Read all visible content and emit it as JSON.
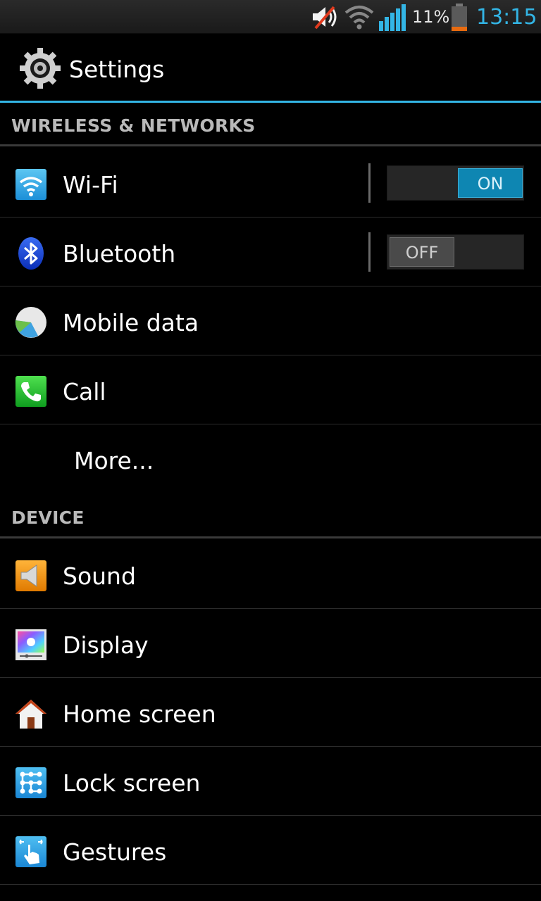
{
  "status_bar": {
    "battery_percent": "11%",
    "time": "13:15",
    "icons": [
      "mute-icon",
      "wifi-signal-icon",
      "cell-signal-icon",
      "battery-low-icon"
    ]
  },
  "action_bar": {
    "title": "Settings",
    "icon": "settings-gear-icon",
    "accent_color": "#33b5e5"
  },
  "sections": {
    "wireless": {
      "header": "WIRELESS & NETWORKS",
      "items": [
        {
          "label": "Wi-Fi",
          "icon": "wifi-icon",
          "toggle": "ON"
        },
        {
          "label": "Bluetooth",
          "icon": "bluetooth-icon",
          "toggle": "OFF"
        },
        {
          "label": "Mobile data",
          "icon": "mobile-data-icon"
        },
        {
          "label": "Call",
          "icon": "phone-icon"
        },
        {
          "label": "More..."
        }
      ]
    },
    "device": {
      "header": "DEVICE",
      "items": [
        {
          "label": "Sound",
          "icon": "speaker-icon"
        },
        {
          "label": "Display",
          "icon": "display-icon"
        },
        {
          "label": "Home screen",
          "icon": "home-icon"
        },
        {
          "label": "Lock screen",
          "icon": "lock-screen-icon"
        },
        {
          "label": "Gestures",
          "icon": "gesture-icon"
        }
      ]
    }
  }
}
